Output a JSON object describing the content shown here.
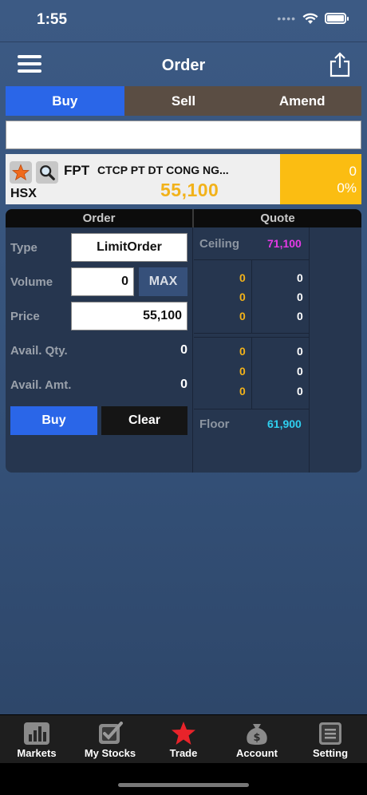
{
  "status_bar": {
    "time": "1:55"
  },
  "nav": {
    "title": "Order"
  },
  "segments": [
    {
      "label": "Buy",
      "active": true
    },
    {
      "label": "Sell",
      "active": false
    },
    {
      "label": "Amend",
      "active": false
    }
  ],
  "symbol_input": {
    "value": ""
  },
  "quote": {
    "code": "FPT",
    "name": "CTCP PT DT CONG NG...",
    "exchange": "HSX",
    "price": "55,100",
    "change": "0",
    "change_pct": "0%"
  },
  "order_panel": {
    "header_order": "Order",
    "header_quote": "Quote",
    "type_label": "Type",
    "type_value": "LimitOrder",
    "volume_label": "Volume",
    "volume_value": "0",
    "max_label": "MAX",
    "price_label": "Price",
    "price_value": "55,100",
    "avail_qty_label": "Avail. Qty.",
    "avail_qty_value": "0",
    "avail_amt_label": "Avail. Amt.",
    "avail_amt_value": "0",
    "buy_label": "Buy",
    "clear_label": "Clear"
  },
  "quote_panel": {
    "ceiling_label": "Ceiling",
    "ceiling_value": "71,100",
    "floor_label": "Floor",
    "floor_value": "61,900",
    "bids": [
      {
        "price": "0",
        "volume": "0"
      },
      {
        "price": "0",
        "volume": "0"
      },
      {
        "price": "0",
        "volume": "0"
      }
    ],
    "asks": [
      {
        "price": "0",
        "volume": "0"
      },
      {
        "price": "0",
        "volume": "0"
      },
      {
        "price": "0",
        "volume": "0"
      }
    ]
  },
  "tab_bar": {
    "items": [
      {
        "label": "Markets",
        "icon": "bar-chart-icon"
      },
      {
        "label": "My Stocks",
        "icon": "checkbox-icon"
      },
      {
        "label": "Trade",
        "icon": "star-icon"
      },
      {
        "label": "Account",
        "icon": "money-bag-icon"
      },
      {
        "label": "Setting",
        "icon": "settings-list-icon"
      }
    ]
  },
  "colors": {
    "accent_blue": "#2a66e8",
    "segment_inactive": "#5a4d43",
    "price_yellow": "#f2b21a",
    "ceiling_magenta": "#e63ae6",
    "floor_cyan": "#2fd0f0",
    "trade_star_red": "#e8232a"
  }
}
